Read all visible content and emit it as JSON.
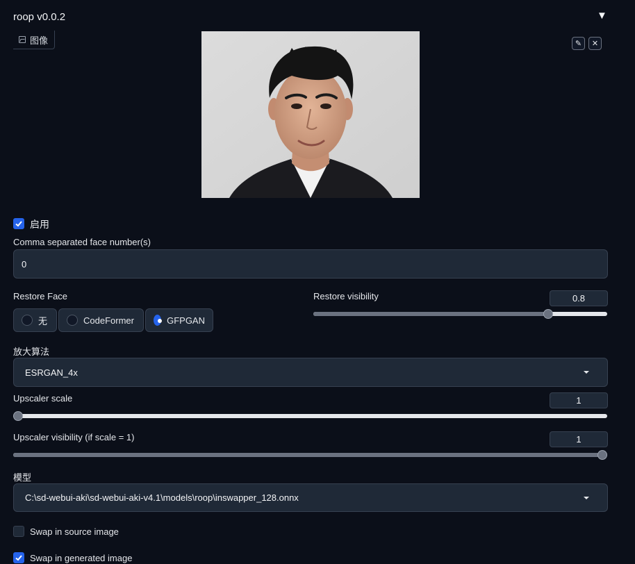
{
  "header": {
    "title": "roop v0.0.2"
  },
  "image_panel": {
    "tab_label": "图像"
  },
  "enable": {
    "label": "启用",
    "checked": true
  },
  "face_numbers": {
    "label": "Comma separated face number(s)",
    "value": "0"
  },
  "restore_face": {
    "label": "Restore Face",
    "options": [
      "无",
      "CodeFormer",
      "GFPGAN"
    ],
    "selected": "GFPGAN"
  },
  "restore_visibility": {
    "label": "Restore visibility",
    "value": "0.8",
    "fraction": 0.8
  },
  "upscaler": {
    "label": "放大算法",
    "value": "ESRGAN_4x"
  },
  "upscaler_scale": {
    "label": "Upscaler scale",
    "value": "1",
    "fraction": 0
  },
  "upscaler_visibility": {
    "label": "Upscaler visibility (if scale = 1)",
    "value": "1",
    "fraction": 1
  },
  "model": {
    "label": "模型",
    "value": "C:\\sd-webui-aki\\sd-webui-aki-v4.1\\models\\roop\\inswapper_128.onnx"
  },
  "swap_source": {
    "label": "Swap in source image",
    "checked": false
  },
  "swap_generated": {
    "label": "Swap in generated image",
    "checked": true
  },
  "colors": {
    "accent": "#2563eb",
    "background": "#0b0f19",
    "panel": "#1f2937"
  }
}
